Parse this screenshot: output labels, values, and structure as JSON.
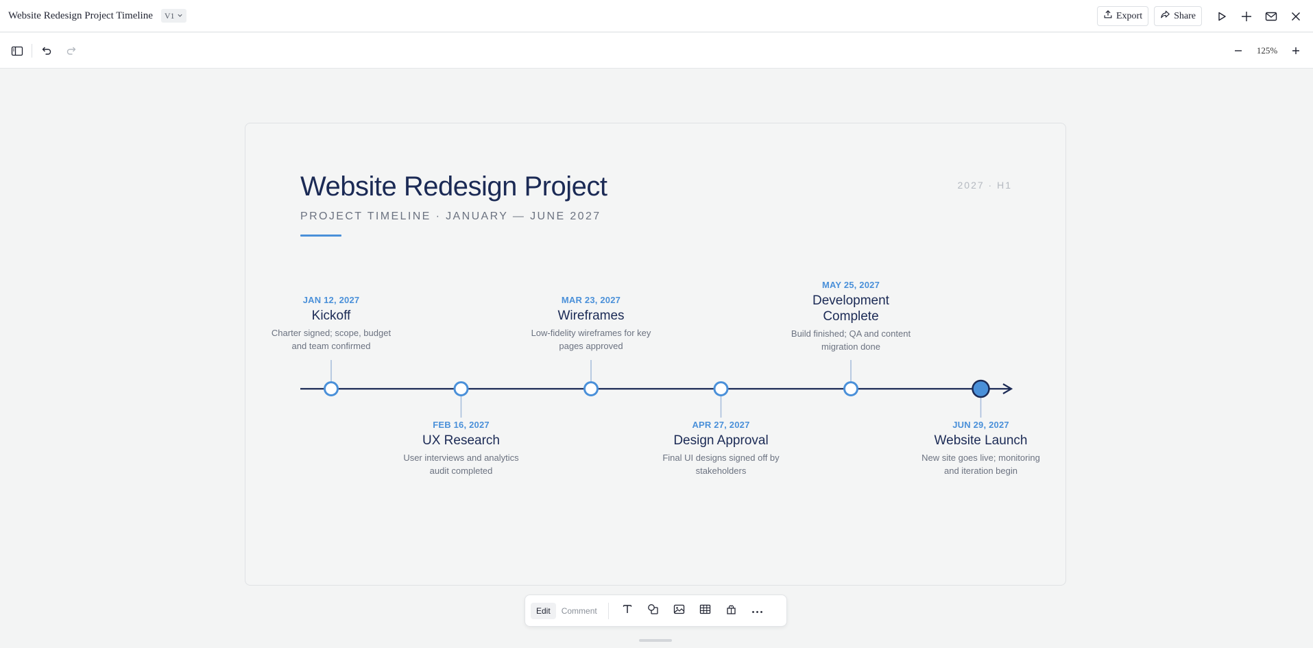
{
  "header": {
    "doc_title": "Website Redesign Project Timeline",
    "version": "V1",
    "export_label": "Export",
    "share_label": "Share"
  },
  "toolbar": {
    "zoom_level": "125%"
  },
  "slide": {
    "title": "Website Redesign Project",
    "subtitle": "PROJECT TIMELINE · JANUARY — JUNE 2027",
    "period": "2027 · H1",
    "milestones": [
      {
        "date": "JAN 12, 2027",
        "name": "Kickoff",
        "desc": "Charter signed; scope, budget and team confirmed",
        "position": "above"
      },
      {
        "date": "FEB 16, 2027",
        "name": "UX Research",
        "desc": "User interviews and analytics audit completed",
        "position": "below"
      },
      {
        "date": "MAR 23, 2027",
        "name": "Wireframes",
        "desc": "Low-fidelity wireframes for key pages approved",
        "position": "above"
      },
      {
        "date": "APR 27, 2027",
        "name": "Design Approval",
        "desc": "Final UI designs signed off by stakeholders",
        "position": "below"
      },
      {
        "date": "MAY 25, 2027",
        "name": "Development Complete",
        "desc": "Build finished; QA and content migration done",
        "position": "above"
      },
      {
        "date": "JUN 29, 2027",
        "name": "Website Launch",
        "desc": "New site goes live; monitoring and iteration begin",
        "position": "below",
        "final": true
      }
    ]
  },
  "bottom_toolbar": {
    "edit_label": "Edit",
    "comment_label": "Comment",
    "active_mode": "Edit"
  },
  "colors": {
    "accent": "#4a90d9",
    "navy": "#1b2a55",
    "muted": "#6b7280"
  },
  "icons": {
    "top": [
      "export-icon",
      "share-icon",
      "play-icon",
      "plus-icon",
      "mail-icon",
      "close-icon"
    ],
    "bottom": [
      "text-icon",
      "shapes-icon",
      "image-icon",
      "table-icon",
      "widget-icon",
      "more-icon"
    ]
  }
}
